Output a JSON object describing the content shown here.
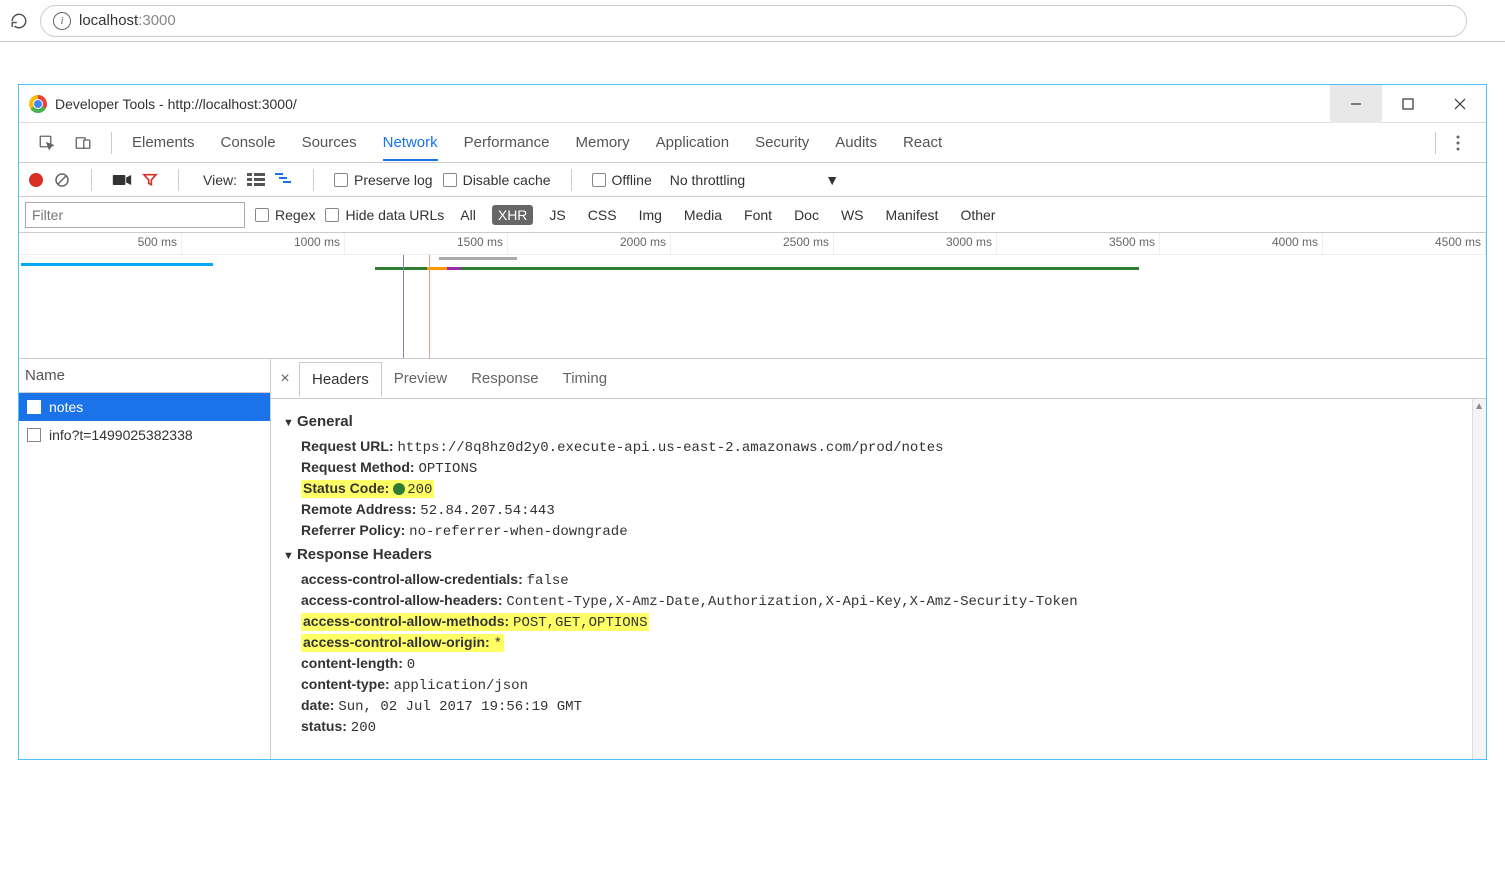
{
  "browser": {
    "url_host": "localhost",
    "url_port": ":3000"
  },
  "titlebar": {
    "text": "Developer Tools - http://localhost:3000/"
  },
  "tabs": [
    "Elements",
    "Console",
    "Sources",
    "Network",
    "Performance",
    "Memory",
    "Application",
    "Security",
    "Audits",
    "React"
  ],
  "active_tab": "Network",
  "network_toolbar": {
    "view_label": "View:",
    "preserve_log": "Preserve log",
    "disable_cache": "Disable cache",
    "offline": "Offline",
    "throttling": "No throttling"
  },
  "filter_bar": {
    "placeholder": "Filter",
    "regex": "Regex",
    "hide_data": "Hide data URLs",
    "types": [
      "All",
      "XHR",
      "JS",
      "CSS",
      "Img",
      "Media",
      "Font",
      "Doc",
      "WS",
      "Manifest",
      "Other"
    ],
    "active_type": "XHR"
  },
  "timeline_ticks": [
    "500 ms",
    "1000 ms",
    "1500 ms",
    "2000 ms",
    "2500 ms",
    "3000 ms",
    "3500 ms",
    "4000 ms",
    "4500 ms"
  ],
  "name_panel": {
    "header": "Name",
    "items": [
      "notes",
      "info?t=1499025382338"
    ],
    "selected": "notes"
  },
  "details_tabs": [
    "Headers",
    "Preview",
    "Response",
    "Timing"
  ],
  "details_active": "Headers",
  "general": {
    "title": "General",
    "items": [
      {
        "k": "Request URL:",
        "v": "https://8q8hz0d2y0.execute-api.us-east-2.amazonaws.com/prod/notes"
      },
      {
        "k": "Request Method:",
        "v": "OPTIONS"
      },
      {
        "k": "Status Code:",
        "v": "200",
        "highlight": true,
        "dot": true
      },
      {
        "k": "Remote Address:",
        "v": "52.84.207.54:443"
      },
      {
        "k": "Referrer Policy:",
        "v": "no-referrer-when-downgrade"
      }
    ]
  },
  "response_headers": {
    "title": "Response Headers",
    "items": [
      {
        "k": "access-control-allow-credentials:",
        "v": "false"
      },
      {
        "k": "access-control-allow-headers:",
        "v": "Content-Type,X-Amz-Date,Authorization,X-Api-Key,X-Amz-Security-Token"
      },
      {
        "k": "access-control-allow-methods:",
        "v": "POST,GET,OPTIONS",
        "highlight": true
      },
      {
        "k": "access-control-allow-origin:",
        "v": "*",
        "highlight": true
      },
      {
        "k": "content-length:",
        "v": "0"
      },
      {
        "k": "content-type:",
        "v": "application/json"
      },
      {
        "k": "date:",
        "v": "Sun, 02 Jul 2017 19:56:19 GMT"
      },
      {
        "k": "status:",
        "v": "200"
      }
    ]
  }
}
